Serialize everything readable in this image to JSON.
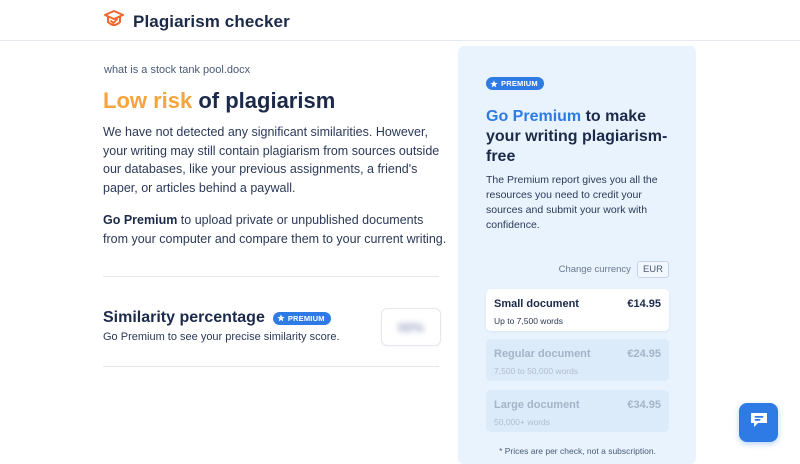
{
  "app": {
    "name": "Plagiarism checker"
  },
  "document": {
    "filename": "what is a stock tank pool.docx"
  },
  "result": {
    "headline_risk": "Low risk",
    "headline_rest": " of plagiarism",
    "paragraph1": "We have not detected any significant similarities. However, your writing may still contain plagiarism from sources outside our databases, like your previous assignments, a friend's paper, or articles behind a paywall.",
    "go_premium_bold": "Go Premium",
    "paragraph2_rest": " to upload private or unpublished documents from your computer and compare them to your current writing."
  },
  "similarity": {
    "title": "Similarity percentage",
    "badge": "PREMIUM",
    "subtitle": "Go Premium to see your precise similarity score.",
    "blurred_value": "00%"
  },
  "premium_panel": {
    "badge": "PREMIUM",
    "title_accent": "Go Premium",
    "title_rest": " to make your writing plagiarism-free",
    "description": "The Premium report gives you all the resources you need to credit your sources and submit your work with confidence.",
    "change_currency_label": "Change currency",
    "currency": "EUR",
    "options": [
      {
        "name": "Small document",
        "price": "€14.95",
        "range": "Up to 7,500 words",
        "selected": true
      },
      {
        "name": "Regular document",
        "price": "€24.95",
        "range": "7,500 to 50,000 words",
        "selected": false
      },
      {
        "name": "Large document",
        "price": "€34.95",
        "range": "50,000+ words",
        "selected": false
      }
    ],
    "note": "* Prices are per check, not a subscription."
  },
  "icons": {
    "logo": "graduation-cap-shield-icon",
    "star": "star-icon",
    "chat": "chat-bubble-icon"
  },
  "colors": {
    "accent_blue": "#2f7be6",
    "risk_orange": "#f5a53b",
    "panel_bg": "#e8f3fd",
    "logo_orange": "#f0662e",
    "text_dark": "#1c2a4a"
  }
}
